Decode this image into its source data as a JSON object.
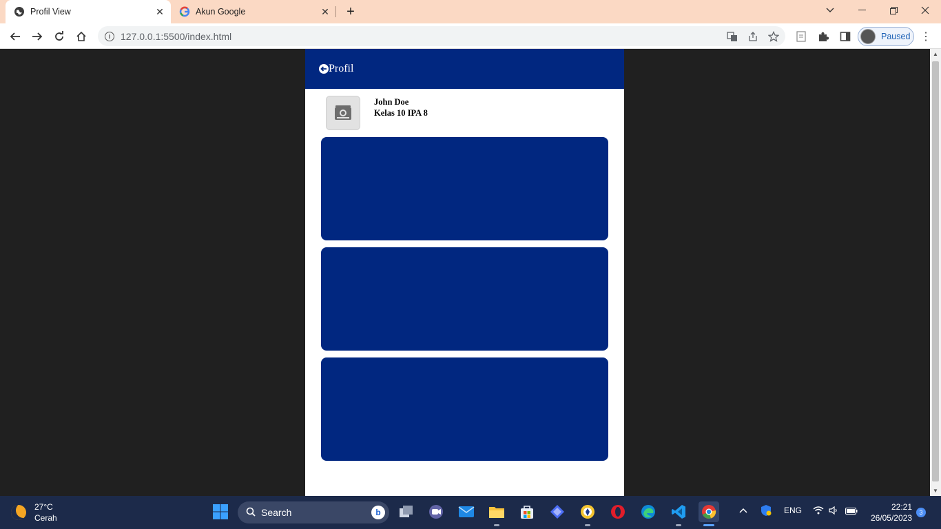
{
  "browser": {
    "tabs": [
      {
        "title": "Profil View",
        "active": true
      },
      {
        "title": "Akun Google",
        "active": false
      }
    ],
    "url": "127.0.0.1:5500/index.html",
    "profile_status": "Paused"
  },
  "page": {
    "header_title": "Profil",
    "user_name": "John Doe",
    "user_class": "Kelas 10 IPA 8",
    "cards": [
      "",
      "",
      ""
    ],
    "colors": {
      "primary": "#012780",
      "background": "#202020"
    }
  },
  "taskbar": {
    "weather_temp": "27°C",
    "weather_desc": "Cerah",
    "search_label": "Search",
    "language": "ENG",
    "time": "22:21",
    "date": "26/05/2023",
    "notification_count": "3"
  }
}
